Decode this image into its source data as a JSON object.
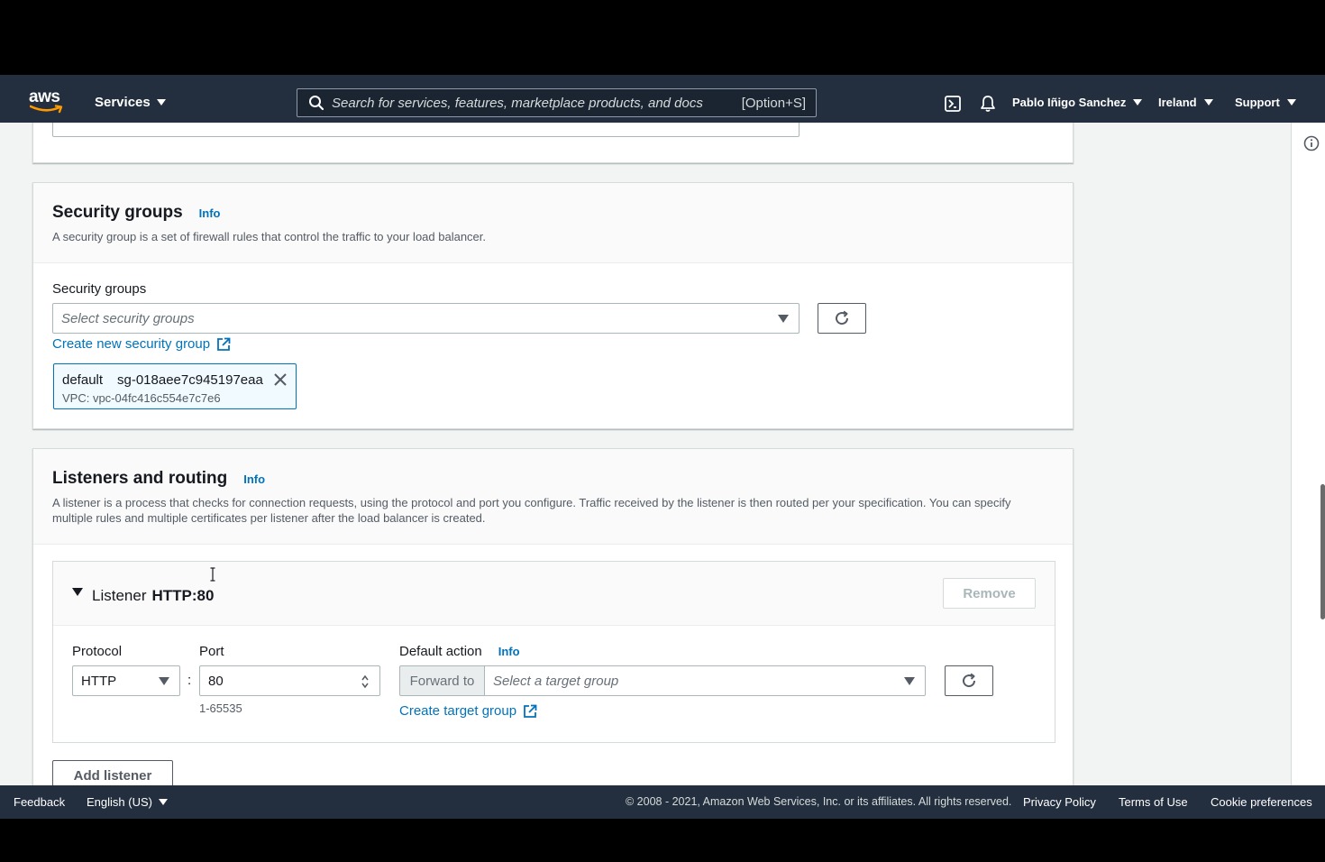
{
  "topnav": {
    "logo_text": "aws",
    "services_label": "Services",
    "search_placeholder": "Search for services, features, marketplace products, and docs",
    "search_shortcut": "[Option+S]",
    "user_name": "Pablo Iñigo Sanchez",
    "region": "Ireland",
    "support": "Support"
  },
  "security_groups": {
    "title": "Security groups",
    "info": "Info",
    "description": "A security group is a set of firewall rules that control the traffic to your load balancer.",
    "field_label": "Security groups",
    "select_placeholder": "Select security groups",
    "create_link": "Create new security group",
    "selected": [
      {
        "name": "default",
        "id": "sg-018aee7c945197eaa",
        "vpc": "VPC: vpc-04fc416c554e7c7e6"
      }
    ]
  },
  "listeners": {
    "title": "Listeners and routing",
    "info": "Info",
    "description": "A listener is a process that checks for connection requests, using the protocol and port you configure. Traffic received by the listener is then routed per your specification. You can specify multiple rules and multiple certificates per listener after the load balancer is created.",
    "listener": {
      "label": "Listener",
      "name": "HTTP:80",
      "remove_label": "Remove",
      "protocol_label": "Protocol",
      "protocol_value": "HTTP",
      "port_label": "Port",
      "port_value": "80",
      "port_hint": "1-65535",
      "colon": ":",
      "default_action_label": "Default action",
      "default_action_info": "Info",
      "forward_to": "Forward to",
      "target_placeholder": "Select a target group",
      "create_target_link": "Create target group"
    },
    "add_listener_label": "Add listener"
  },
  "footer": {
    "feedback": "Feedback",
    "language": "English (US)",
    "copyright": "© 2008 - 2021, Amazon Web Services, Inc. or its affiliates. All rights reserved.",
    "privacy": "Privacy Policy",
    "terms": "Terms of Use",
    "cookies": "Cookie preferences"
  },
  "colors": {
    "nav_bg": "#232f3e",
    "link": "#0073bb",
    "page_bg": "#f2f3f3",
    "token_bg": "#f1faff"
  }
}
